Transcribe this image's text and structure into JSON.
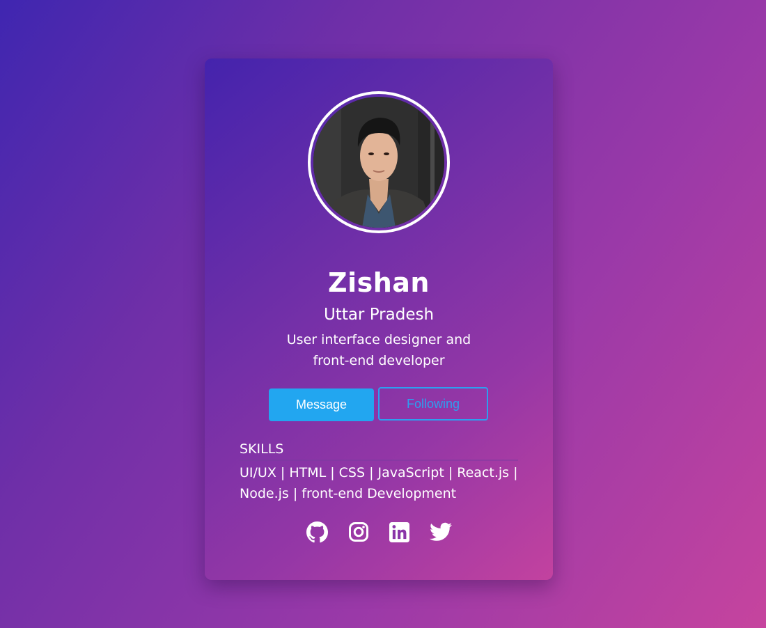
{
  "profile": {
    "name": "Zishan",
    "location": "Uttar Pradesh",
    "bio": "User interface designer and front-end developer"
  },
  "actions": {
    "message_label": "Message",
    "following_label": "Following"
  },
  "skills": {
    "title": "SKILLS",
    "list": "UI/UX | HTML | CSS | JavaScript | React.js | Node.js | front-end Development"
  },
  "social": [
    "github-icon",
    "instagram-icon",
    "linkedin-icon",
    "twitter-icon"
  ],
  "colors": {
    "accent": "#22a6f0",
    "outline": "#2d9ff0",
    "background_start": "#3f26b0",
    "background_end": "#c6449e"
  }
}
